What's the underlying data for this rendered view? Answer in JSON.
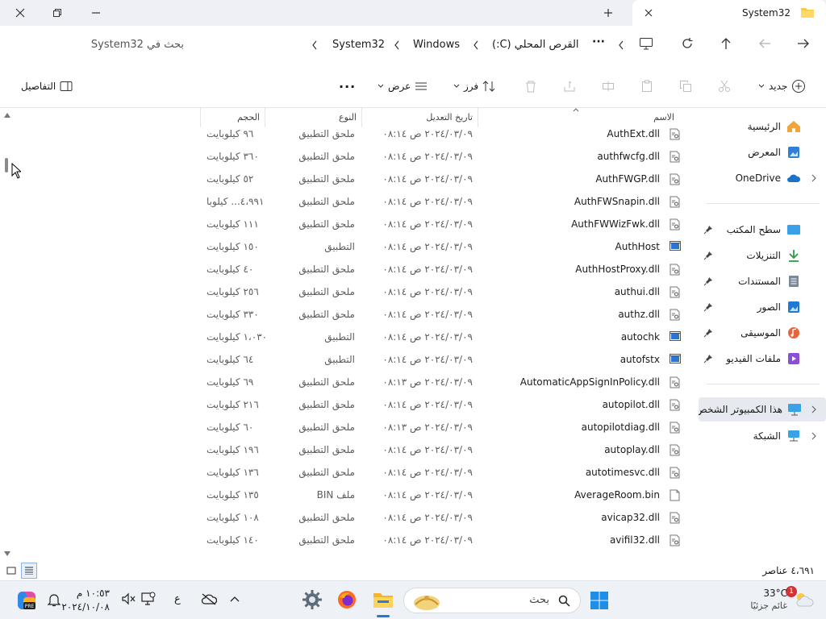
{
  "window": {
    "tab_title": "System32"
  },
  "address": {
    "segments": [
      "System32",
      "Windows",
      "القرص المحلي (C:)"
    ],
    "search_placeholder": "بحث في System32"
  },
  "toolbar": {
    "new_label": "جديد",
    "sort_label": "فرز",
    "view_label": "عرض",
    "details_label": "التفاصيل"
  },
  "nav": {
    "items": [
      {
        "label": "الرئيسية",
        "icon": "home-icon"
      },
      {
        "label": "المعرض",
        "icon": "gallery-icon"
      },
      {
        "label": "OneDrive",
        "icon": "onedrive-icon"
      },
      {
        "label": "سطح المكتب",
        "icon": "desktop-icon"
      },
      {
        "label": "التنزيلات",
        "icon": "downloads-icon"
      },
      {
        "label": "المستندات",
        "icon": "documents-icon"
      },
      {
        "label": "الصور",
        "icon": "pictures-icon"
      },
      {
        "label": "الموسيقى",
        "icon": "music-icon"
      },
      {
        "label": "ملفات الفيديو",
        "icon": "videos-icon"
      },
      {
        "label": "هذا الكمبيوتر الشخص",
        "icon": "this-pc-icon"
      },
      {
        "label": "الشبكة",
        "icon": "network-icon"
      }
    ]
  },
  "table": {
    "headers": {
      "name": "الاسم",
      "date": "تاريخ التعديل",
      "type": "النوع",
      "size": "الحجم"
    },
    "rows": [
      {
        "name": "AuthExt.dll",
        "date": "٢٠٢٤/٠٣/٠٩ ص ٠٨:١٤",
        "type": "ملحق التطبيق",
        "size": "٩٦ كيلوبايت",
        "icon": "dll-file-icon"
      },
      {
        "name": "authfwcfg.dll",
        "date": "٢٠٢٤/٠٣/٠٩ ص ٠٨:١٤",
        "type": "ملحق التطبيق",
        "size": "٣٦٠ كيلوبايت",
        "icon": "dll-file-icon"
      },
      {
        "name": "AuthFWGP.dll",
        "date": "٢٠٢٤/٠٣/٠٩ ص ٠٨:١٤",
        "type": "ملحق التطبيق",
        "size": "٥٢ كيلوبايت",
        "icon": "dll-file-icon"
      },
      {
        "name": "AuthFWSnapin.dll",
        "date": "٢٠٢٤/٠٣/٠٩ ص ٠٨:١٤",
        "type": "ملحق التطبيق",
        "size": "٤،٩٩١... كيلوبا",
        "icon": "dll-file-icon"
      },
      {
        "name": "AuthFWWizFwk.dll",
        "date": "٢٠٢٤/٠٣/٠٩ ص ٠٨:١٤",
        "type": "ملحق التطبيق",
        "size": "١١١ كيلوبايت",
        "icon": "dll-file-icon"
      },
      {
        "name": "AuthHost",
        "date": "٢٠٢٤/٠٣/٠٩ ص ٠٨:١٤",
        "type": "التطبيق",
        "size": "١٥٠ كيلوبايت",
        "icon": "exe-file-icon"
      },
      {
        "name": "AuthHostProxy.dll",
        "date": "٢٠٢٤/٠٣/٠٩ ص ٠٨:١٤",
        "type": "ملحق التطبيق",
        "size": "٤٠ كيلوبايت",
        "icon": "dll-file-icon"
      },
      {
        "name": "authui.dll",
        "date": "٢٠٢٤/٠٣/٠٩ ص ٠٨:١٤",
        "type": "ملحق التطبيق",
        "size": "٢٥٦ كيلوبايت",
        "icon": "dll-file-icon"
      },
      {
        "name": "authz.dll",
        "date": "٢٠٢٤/٠٣/٠٩ ص ٠٨:١٤",
        "type": "ملحق التطبيق",
        "size": "٣٣٠ كيلوبايت",
        "icon": "dll-file-icon"
      },
      {
        "name": "autochk",
        "date": "٢٠٢٤/٠٣/٠٩ ص ٠٨:١٤",
        "type": "التطبيق",
        "size": "١،٠٣٠ كيلوبايت",
        "icon": "exe-file-icon"
      },
      {
        "name": "autofstx",
        "date": "٢٠٢٤/٠٣/٠٩ ص ٠٨:١٤",
        "type": "التطبيق",
        "size": "٦٤ كيلوبايت",
        "icon": "exe-file-icon"
      },
      {
        "name": "AutomaticAppSignInPolicy.dll",
        "date": "٢٠٢٤/٠٣/٠٩ ص ٠٨:١٣",
        "type": "ملحق التطبيق",
        "size": "٦٩ كيلوبايت",
        "icon": "dll-file-icon"
      },
      {
        "name": "autopilot.dll",
        "date": "٢٠٢٤/٠٣/٠٩ ص ٠٨:١٤",
        "type": "ملحق التطبيق",
        "size": "٢١٦ كيلوبايت",
        "icon": "dll-file-icon"
      },
      {
        "name": "autopilotdiag.dll",
        "date": "٢٠٢٤/٠٣/٠٩ ص ٠٨:١٣",
        "type": "ملحق التطبيق",
        "size": "٦٠ كيلوبايت",
        "icon": "dll-file-icon"
      },
      {
        "name": "autoplay.dll",
        "date": "٢٠٢٤/٠٣/٠٩ ص ٠٨:١٤",
        "type": "ملحق التطبيق",
        "size": "١٩٦ كيلوبايت",
        "icon": "dll-file-icon"
      },
      {
        "name": "autotimesvc.dll",
        "date": "٢٠٢٤/٠٣/٠٩ ص ٠٨:١٤",
        "type": "ملحق التطبيق",
        "size": "١٣٦ كيلوبايت",
        "icon": "dll-file-icon"
      },
      {
        "name": "AverageRoom.bin",
        "date": "٢٠٢٤/٠٣/٠٩ ص ٠٨:١٤",
        "type": "ملف BIN",
        "size": "١٣٥ كيلوبايت",
        "icon": "bin-file-icon"
      },
      {
        "name": "avicap32.dll",
        "date": "٢٠٢٤/٠٣/٠٩ ص ٠٨:١٤",
        "type": "ملحق التطبيق",
        "size": "١٠٨ كيلوبايت",
        "icon": "dll-file-icon"
      },
      {
        "name": "avifil32.dll",
        "date": "٢٠٢٤/٠٣/٠٩ ص ٠٨:١٤",
        "type": "ملحق التطبيق",
        "size": "١٤٠ كيلوبايت",
        "icon": "dll-file-icon"
      }
    ]
  },
  "status": {
    "item_count": "٤،٦٩١ عناصر"
  },
  "taskbar": {
    "weather_temp": "33°C",
    "weather_desc": "غائم جزئيًا",
    "weather_badge": "1",
    "search_label": "بحث",
    "clock_time": "١٠:٥٣ م",
    "clock_date": "٢٠٢٤/١٠/٠٨",
    "lang": "ع"
  }
}
